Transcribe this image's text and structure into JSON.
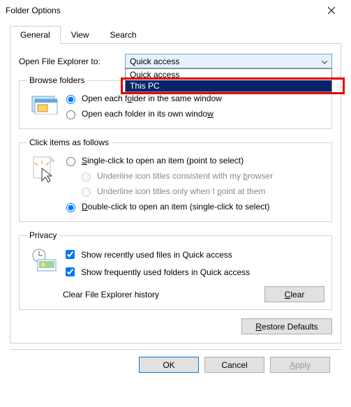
{
  "window": {
    "title": "Folder Options"
  },
  "tabs": {
    "general": "General",
    "view": "View",
    "search": "Search"
  },
  "open_to": {
    "label": "Open File Explorer to:",
    "selected": "Quick access",
    "options": [
      "Quick access",
      "This PC"
    ],
    "highlighted_index": 1
  },
  "browse": {
    "legend": "Browse folders",
    "same": "Open each folder in the same window",
    "own": "Open each folder in its own window"
  },
  "click": {
    "legend": "Click items as follows",
    "single": "Single-click to open an item (point to select)",
    "und_browser": "Underline icon titles consistent with my browser",
    "und_point": "Underline icon titles only when I point at them",
    "double": "Double-click to open an item (single-click to select)"
  },
  "privacy": {
    "legend": "Privacy",
    "recent": "Show recently used files in Quick access",
    "frequent": "Show frequently used folders in Quick access",
    "clear_label": "Clear File Explorer history",
    "clear_btn": "Clear"
  },
  "restore": "Restore Defaults",
  "buttons": {
    "ok": "OK",
    "cancel": "Cancel",
    "apply": "Apply"
  }
}
